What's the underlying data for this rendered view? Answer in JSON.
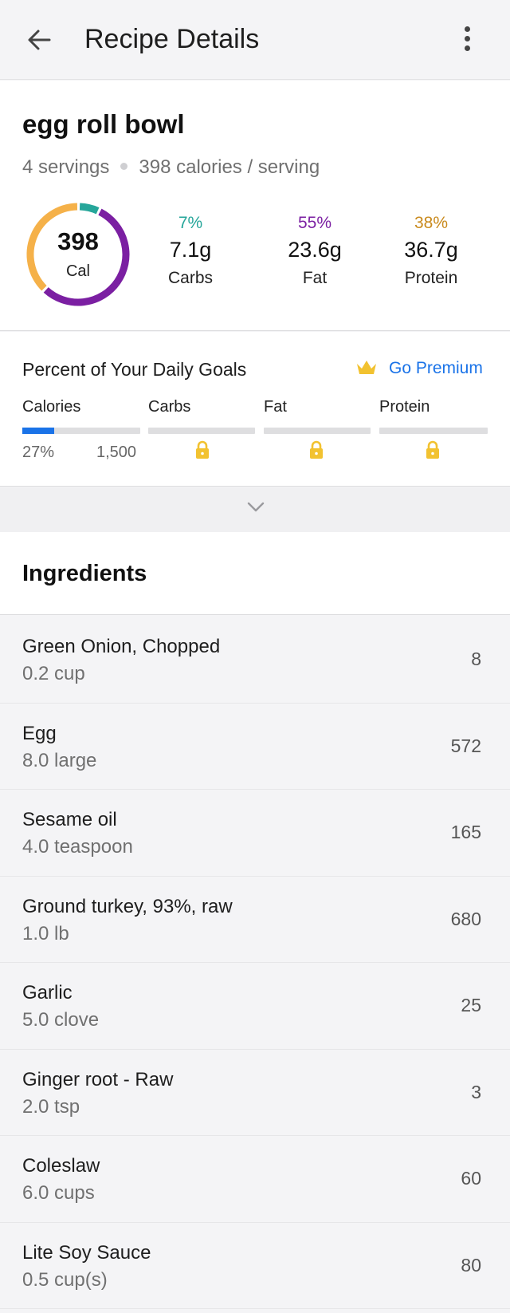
{
  "header": {
    "title": "Recipe Details",
    "back_icon": "arrow-left-icon",
    "menu_icon": "more-vertical-icon"
  },
  "recipe": {
    "name": "egg roll bowl",
    "servings": "4 servings",
    "calories_per_serving": "398 calories / serving",
    "calories_value": "398",
    "calories_unit": "Cal"
  },
  "macros": [
    {
      "percent": "7%",
      "grams": "7.1g",
      "name": "Carbs",
      "color": "#26a69a"
    },
    {
      "percent": "55%",
      "grams": "23.6g",
      "name": "Fat",
      "color": "#7b1fa2"
    },
    {
      "percent": "38%",
      "grams": "36.7g",
      "name": "Protein",
      "color": "#c98a1d"
    }
  ],
  "goals": {
    "title": "Percent of Your Daily Goals",
    "premium_label": "Go Premium",
    "premium_icon": "crown-icon",
    "accent": "#1a73e8",
    "calories": {
      "label": "Calories",
      "percent": "27%",
      "goal": "1,500",
      "progress": 0.27
    },
    "carbs": {
      "label": "Carbs",
      "locked": true
    },
    "fat": {
      "label": "Fat",
      "locked": true
    },
    "protein": {
      "label": "Protein",
      "locked": true
    }
  },
  "collapse_icon": "chevron-down-icon",
  "ingredients": {
    "title": "Ingredients",
    "items": [
      {
        "name": "Green Onion, Chopped",
        "quantity": "0.2 cup",
        "calories": "8"
      },
      {
        "name": "Egg",
        "quantity": "8.0 large",
        "calories": "572"
      },
      {
        "name": "Sesame oil",
        "quantity": "4.0 teaspoon",
        "calories": "165"
      },
      {
        "name": "Ground turkey, 93%, raw",
        "quantity": "1.0 lb",
        "calories": "680"
      },
      {
        "name": "Garlic",
        "quantity": "5.0 clove",
        "calories": "25"
      },
      {
        "name": "Ginger root - Raw",
        "quantity": "2.0 tsp",
        "calories": "3"
      },
      {
        "name": "Coleslaw",
        "quantity": "6.0 cups",
        "calories": "60"
      },
      {
        "name": "Lite Soy Sauce",
        "quantity": "0.5 cup(s)",
        "calories": "80"
      }
    ]
  }
}
